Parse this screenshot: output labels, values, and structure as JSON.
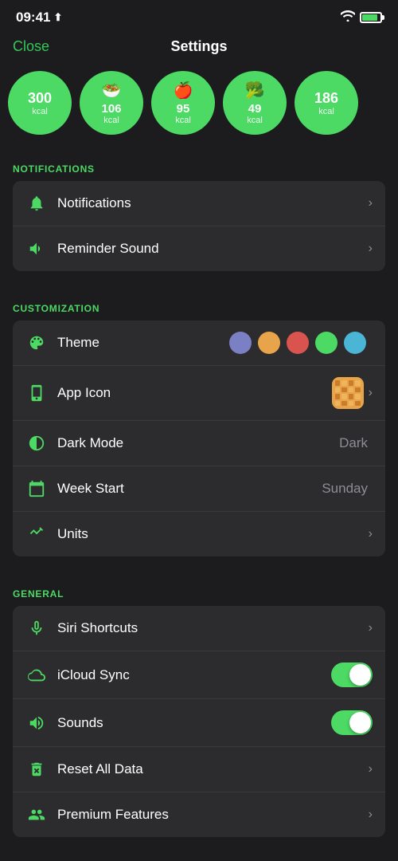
{
  "statusBar": {
    "time": "09:41",
    "locationArrow": "↗"
  },
  "navBar": {
    "closeLabel": "Close",
    "title": "Settings"
  },
  "foodCircles": [
    {
      "id": 1,
      "value": "300",
      "unit": "kcal",
      "hasIcon": false
    },
    {
      "id": 2,
      "value": "106",
      "unit": "kcal",
      "hasIcon": true,
      "emoji": "🥗"
    },
    {
      "id": 3,
      "value": "95",
      "unit": "kcal",
      "hasIcon": true,
      "emoji": "🍎"
    },
    {
      "id": 4,
      "value": "49",
      "unit": "kcal",
      "hasIcon": true,
      "emoji": "🥦"
    },
    {
      "id": 5,
      "value": "186",
      "unit": "kcal",
      "hasIcon": false
    }
  ],
  "sections": {
    "notifications": {
      "header": "NOTIFICATIONS",
      "rows": [
        {
          "id": "notifications",
          "label": "Notifications",
          "type": "chevron",
          "value": ""
        },
        {
          "id": "reminder-sound",
          "label": "Reminder Sound",
          "type": "chevron",
          "value": ""
        }
      ]
    },
    "customization": {
      "header": "CUSTOMIZATION",
      "rows": [
        {
          "id": "theme",
          "label": "Theme",
          "type": "colors",
          "value": ""
        },
        {
          "id": "app-icon",
          "label": "App Icon",
          "type": "icon-chevron",
          "value": ""
        },
        {
          "id": "dark-mode",
          "label": "Dark Mode",
          "type": "value",
          "value": "Dark"
        },
        {
          "id": "week-start",
          "label": "Week Start",
          "type": "value",
          "value": "Sunday"
        },
        {
          "id": "units",
          "label": "Units",
          "type": "chevron",
          "value": ""
        }
      ]
    },
    "general": {
      "header": "GENERAL",
      "rows": [
        {
          "id": "siri-shortcuts",
          "label": "Siri Shortcuts",
          "type": "chevron",
          "value": ""
        },
        {
          "id": "icloud-sync",
          "label": "iCloud Sync",
          "type": "toggle",
          "value": ""
        },
        {
          "id": "sounds",
          "label": "Sounds",
          "type": "toggle",
          "value": ""
        },
        {
          "id": "reset-all-data",
          "label": "Reset All Data",
          "type": "chevron",
          "value": ""
        },
        {
          "id": "premium-features",
          "label": "Premium Features",
          "type": "chevron-partial",
          "value": ""
        }
      ]
    }
  },
  "themeColors": [
    "#7b7fc4",
    "#e8a44a",
    "#d9534f",
    "#4cd964",
    "#4ab5d4"
  ],
  "accentColor": "#4cd964"
}
